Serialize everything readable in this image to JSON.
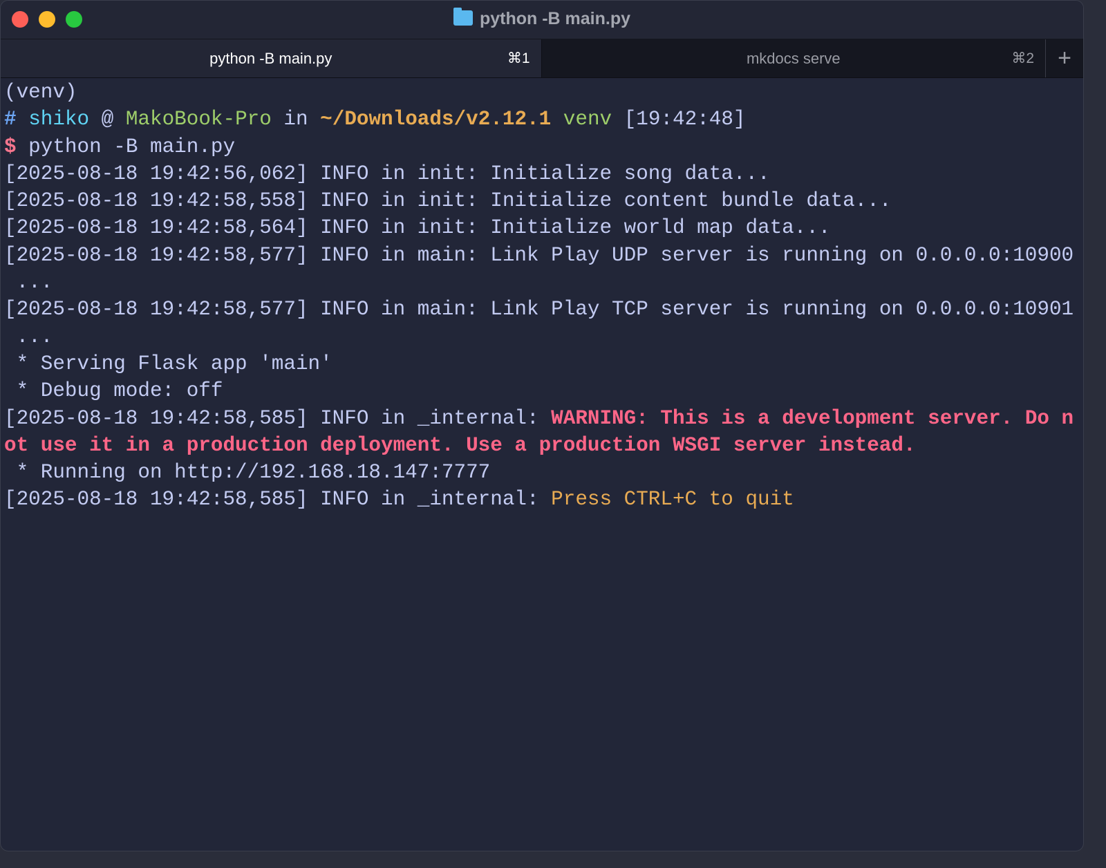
{
  "window": {
    "title": "python -B main.py"
  },
  "tabs": [
    {
      "label": "python -B main.py",
      "shortcut": "⌘1",
      "active": true
    },
    {
      "label": "mkdocs serve",
      "shortcut": "⌘2",
      "active": false
    }
  ],
  "new_tab": "+",
  "colors": {
    "background": "#222638",
    "text": "#c3cbf2",
    "warning": "#ff6688",
    "path": "#e8ab53",
    "host": "#9ece6a",
    "user": "#5fd3f3"
  },
  "terminal_lines": [
    [
      {
        "t": "(venv)",
        "c": "default"
      }
    ],
    [
      {
        "t": "#",
        "c": "blue"
      },
      {
        "t": " ",
        "c": "default"
      },
      {
        "t": "shiko",
        "c": "cyan"
      },
      {
        "t": " @ ",
        "c": "default"
      },
      {
        "t": "MakoBook-Pro",
        "c": "green"
      },
      {
        "t": " in ",
        "c": "default"
      },
      {
        "t": "~/Downloads/v2.12.1",
        "c": "orangeb"
      },
      {
        "t": " ",
        "c": "default"
      },
      {
        "t": "venv",
        "c": "green"
      },
      {
        "t": " [19:42:48]",
        "c": "default"
      }
    ],
    [
      {
        "t": "$",
        "c": "pink"
      },
      {
        "t": " python -B main.py",
        "c": "default"
      }
    ],
    [
      {
        "t": "[2025-08-18 19:42:56,062] INFO in init: Initialize song data...",
        "c": "default"
      }
    ],
    [
      {
        "t": "[2025-08-18 19:42:58,558] INFO in init: Initialize content bundle data...",
        "c": "default"
      }
    ],
    [
      {
        "t": "[2025-08-18 19:42:58,564] INFO in init: Initialize world map data...",
        "c": "default"
      }
    ],
    [
      {
        "t": "[2025-08-18 19:42:58,577] INFO in main: Link Play UDP server is running on 0.0.0.0:10900",
        "c": "default"
      }
    ],
    [
      {
        "t": " ...",
        "c": "default"
      }
    ],
    [
      {
        "t": "[2025-08-18 19:42:58,577] INFO in main: Link Play TCP server is running on 0.0.0.0:10901",
        "c": "default"
      }
    ],
    [
      {
        "t": " ...",
        "c": "default"
      }
    ],
    [
      {
        "t": " * Serving Flask app 'main'",
        "c": "default"
      }
    ],
    [
      {
        "t": " * Debug mode: off",
        "c": "default"
      }
    ],
    [
      {
        "t": "[2025-08-18 19:42:58,585] INFO in _internal: ",
        "c": "default"
      },
      {
        "t": "WARNING: This is a development server. Do n",
        "c": "red"
      }
    ],
    [
      {
        "t": "ot use it in a production deployment. Use a production WSGI server instead.",
        "c": "red"
      }
    ],
    [
      {
        "t": " * Running on http://192.168.18.147:7777",
        "c": "default"
      }
    ],
    [
      {
        "t": "[2025-08-18 19:42:58,585] INFO in _internal: ",
        "c": "default"
      },
      {
        "t": "Press CTRL+C to quit",
        "c": "orange"
      }
    ]
  ]
}
